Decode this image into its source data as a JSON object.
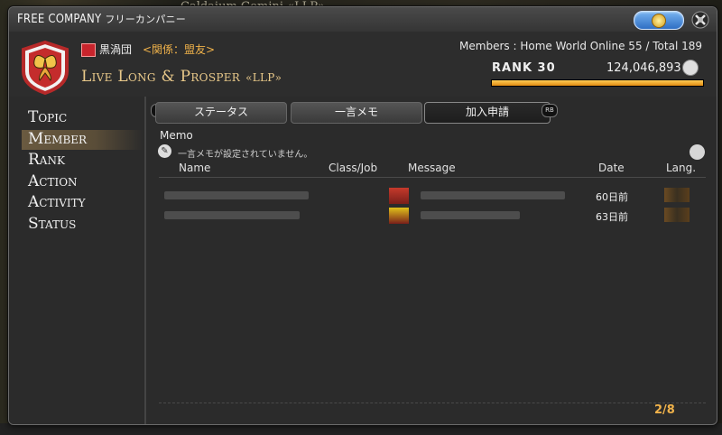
{
  "background": {
    "game_text": "Caldaium Gemini «LLP»"
  },
  "window": {
    "title": "FREE COMPANY",
    "title_sub": "フリーカンパニー",
    "pill_icon": "gil-coin-icon",
    "close_icon": "close-x-icon"
  },
  "header": {
    "grand_company": "黒渦団",
    "relation": "<関係：盟友>",
    "fc_name": "Live Long & Prosper",
    "fc_tag": "«LLP»",
    "members_line": "Members : Home World Online 55 / Total 189",
    "rank_label": "RANK 30",
    "rank_points": "124,046,893",
    "rank_progress": 1.0
  },
  "sidebar": {
    "items": [
      {
        "label": "Topic"
      },
      {
        "label": "Member"
      },
      {
        "label": "Rank"
      },
      {
        "label": "Action"
      },
      {
        "label": "Activity"
      },
      {
        "label": "Status"
      }
    ],
    "selected_index": 1
  },
  "tabs": {
    "lb": "LB",
    "rb": "RB",
    "items": [
      {
        "label": "ステータス"
      },
      {
        "label": "一言メモ"
      },
      {
        "label": "加入申請"
      }
    ],
    "active_index": 2
  },
  "memo": {
    "label": "Memo",
    "text": "一言メモが設定されていません。"
  },
  "table": {
    "headers": {
      "name": "Name",
      "class_job": "Class/Job",
      "message": "Message",
      "date": "Date",
      "lang": "Lang."
    },
    "rows": [
      {
        "date": "60日前",
        "job_color": "#c63a2c"
      },
      {
        "date": "63日前",
        "job_color": "#e0c21a"
      }
    ]
  },
  "pagination": {
    "text": "2/8"
  },
  "colors": {
    "accent_orange": "#f0b24a",
    "pill_blue": "#3e82d6",
    "rank_bar": "#f0a020"
  }
}
